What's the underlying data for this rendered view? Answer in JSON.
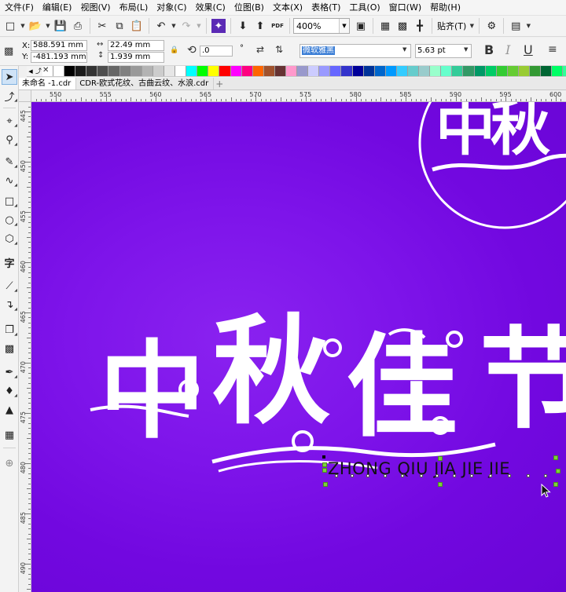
{
  "menu": [
    "文件(F)",
    "编辑(E)",
    "视图(V)",
    "布局(L)",
    "对象(C)",
    "效果(C)",
    "位图(B)",
    "文本(X)",
    "表格(T)",
    "工具(O)",
    "窗口(W)",
    "帮助(H)"
  ],
  "toolbar": {
    "zoom_value": "400%",
    "snap_label": "贴齐(T)",
    "pdf_label": "PDF"
  },
  "propbar": {
    "x_label": "X:",
    "x_value": "588.591 mm",
    "y_label": "Y:",
    "y_value": "-481.193 mm",
    "width_value": "22.49 mm",
    "height_value": "1.939 mm",
    "rotation_value": ".0",
    "degree_symbol": "°",
    "font_name": "微软雅黑",
    "font_size": "5.63 pt",
    "bold_label": "B",
    "italic_label": "I",
    "underline_label": "U"
  },
  "palette_colors": [
    "#ffffff",
    "#000000",
    "#1a1a1a",
    "#333333",
    "#4d4d4d",
    "#666666",
    "#808080",
    "#999999",
    "#b3b3b3",
    "#cccccc",
    "#e6e6e6",
    "#ffffff",
    "#00ffff",
    "#00ff00",
    "#ffff00",
    "#ff0000",
    "#ff00ff",
    "#ff0080",
    "#ff6600",
    "#a0522d",
    "#663333",
    "#ff99cc",
    "#9999cc",
    "#ccccff",
    "#9999ff",
    "#6666ff",
    "#3333cc",
    "#000099",
    "#003399",
    "#0066cc",
    "#0099ff",
    "#33ccff",
    "#66cccc",
    "#99cccc",
    "#99ffcc",
    "#66ffcc",
    "#33cc99",
    "#339966",
    "#009966",
    "#00cc66",
    "#33cc33",
    "#66cc33",
    "#99cc33",
    "#339933",
    "#006633",
    "#00ff66",
    "#33ff99",
    "#00cc99"
  ],
  "tabs": [
    {
      "label": "未命名 -1.cdr",
      "active": true
    },
    {
      "label": "CDR-欧式花纹、古曲云纹、水浪.cdr",
      "active": false
    }
  ],
  "ruler": {
    "h_labels": [
      "550",
      "555",
      "560",
      "565",
      "570",
      "575",
      "580",
      "585",
      "590",
      "595",
      "600"
    ],
    "v_labels": [
      "445",
      "450",
      "455",
      "460",
      "465",
      "470",
      "475",
      "480",
      "485",
      "490"
    ]
  },
  "canvas": {
    "title_chars": [
      "中",
      "秋",
      "佳",
      "节"
    ],
    "top_chars": "中秋",
    "pinyin_text": "ZHONG QIU JIA JIE JIE",
    "background_color": "#7a10e6",
    "text_color": "#ffffff"
  }
}
